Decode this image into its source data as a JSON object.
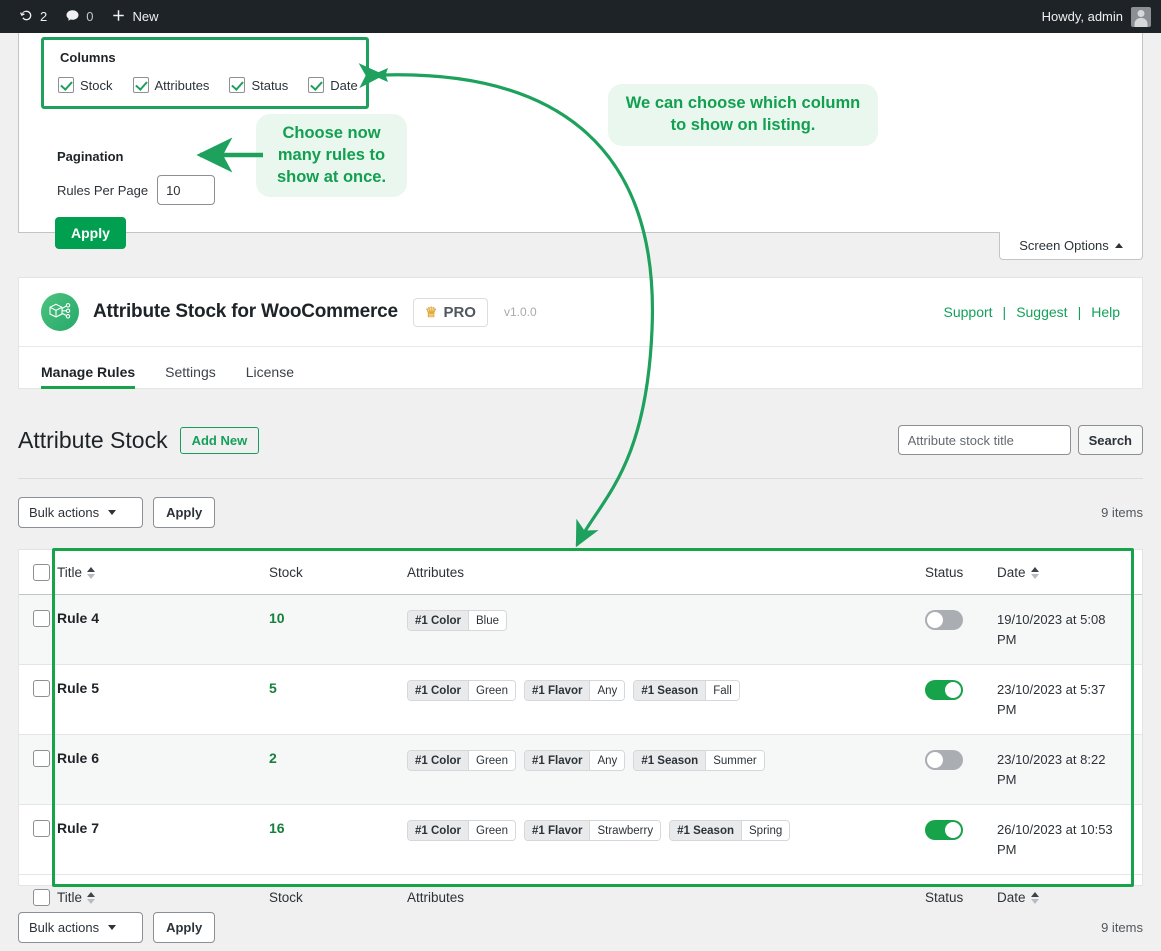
{
  "adminbar": {
    "updates_count": "2",
    "comments_count": "0",
    "new_label": "New",
    "howdy": "Howdy, admin"
  },
  "screen_options": {
    "columns_title": "Columns",
    "columns": [
      {
        "label": "Stock",
        "checked": true
      },
      {
        "label": "Attributes",
        "checked": true
      },
      {
        "label": "Status",
        "checked": true
      },
      {
        "label": "Date",
        "checked": true
      }
    ],
    "pagination_title": "Pagination",
    "rules_per_page_label": "Rules Per Page",
    "rules_per_page_value": "10",
    "apply_label": "Apply",
    "screen_options_tab": "Screen Options"
  },
  "callouts": {
    "pagination": "Choose now many rules to show at once.",
    "columns": "We can choose which column to show on listing."
  },
  "plugin": {
    "name": "Attribute Stock for WooCommerce",
    "pro_badge": "PRO",
    "version": "v1.0.0",
    "links": [
      {
        "label": "Support"
      },
      {
        "label": "Suggest"
      },
      {
        "label": "Help"
      }
    ],
    "link_separator": "|",
    "tabs": [
      {
        "label": "Manage Rules",
        "active": true
      },
      {
        "label": "Settings",
        "active": false
      },
      {
        "label": "License",
        "active": false
      }
    ]
  },
  "page": {
    "title": "Attribute Stock",
    "add_new_label": "Add New",
    "search_placeholder": "Attribute stock title",
    "search_value": "",
    "search_button": "Search"
  },
  "tablenav": {
    "bulk_actions_label": "Bulk actions",
    "apply_label": "Apply",
    "items_count": "9 items"
  },
  "table": {
    "columns": [
      {
        "key": "title",
        "label": "Title",
        "sortable": true
      },
      {
        "key": "stock",
        "label": "Stock",
        "sortable": false
      },
      {
        "key": "attrs",
        "label": "Attributes",
        "sortable": false
      },
      {
        "key": "status",
        "label": "Status",
        "sortable": false
      },
      {
        "key": "date",
        "label": "Date",
        "sortable": true
      }
    ],
    "rows": [
      {
        "title": "Rule 4",
        "stock": "10",
        "attributes": [
          {
            "key": "#1 Color",
            "value": "Blue"
          }
        ],
        "status_on": false,
        "date": "19/10/2023 at 5:08 PM"
      },
      {
        "title": "Rule 5",
        "stock": "5",
        "attributes": [
          {
            "key": "#1 Color",
            "value": "Green"
          },
          {
            "key": "#1 Flavor",
            "value": "Any"
          },
          {
            "key": "#1 Season",
            "value": "Fall"
          }
        ],
        "status_on": true,
        "date": "23/10/2023 at 5:37 PM"
      },
      {
        "title": "Rule 6",
        "stock": "2",
        "attributes": [
          {
            "key": "#1 Color",
            "value": "Green"
          },
          {
            "key": "#1 Flavor",
            "value": "Any"
          },
          {
            "key": "#1 Season",
            "value": "Summer"
          }
        ],
        "status_on": false,
        "date": "23/10/2023 at 8:22 PM"
      },
      {
        "title": "Rule 7",
        "stock": "16",
        "attributes": [
          {
            "key": "#1 Color",
            "value": "Green"
          },
          {
            "key": "#1 Flavor",
            "value": "Strawberry"
          },
          {
            "key": "#1 Season",
            "value": "Spring"
          }
        ],
        "status_on": true,
        "date": "26/10/2023 at 10:53 PM"
      }
    ]
  },
  "colors": {
    "accent_green": "#16a34a",
    "button_green": "#00a050",
    "link_green": "#14a05a",
    "stock_green": "#16803c",
    "callout_bg": "#eaf7ef",
    "callout_text": "#12a050",
    "admin_bar": "#1d2327",
    "page_bg": "#f0f0f1"
  }
}
